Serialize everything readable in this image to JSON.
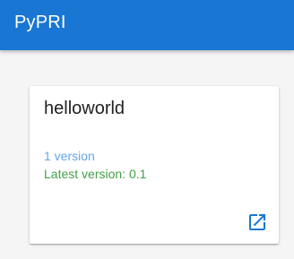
{
  "appbar": {
    "title": "PyPRI"
  },
  "package": {
    "name": "helloworld",
    "versions_text": "1 version",
    "latest_version_text": "Latest version: 0.1"
  },
  "icons": {
    "open": "open-in-new-icon"
  },
  "colors": {
    "primary": "#1976d2",
    "versions_text": "#64a6e8",
    "latest_text": "#43a047",
    "background": "#f5f5f5",
    "card": "#ffffff"
  }
}
